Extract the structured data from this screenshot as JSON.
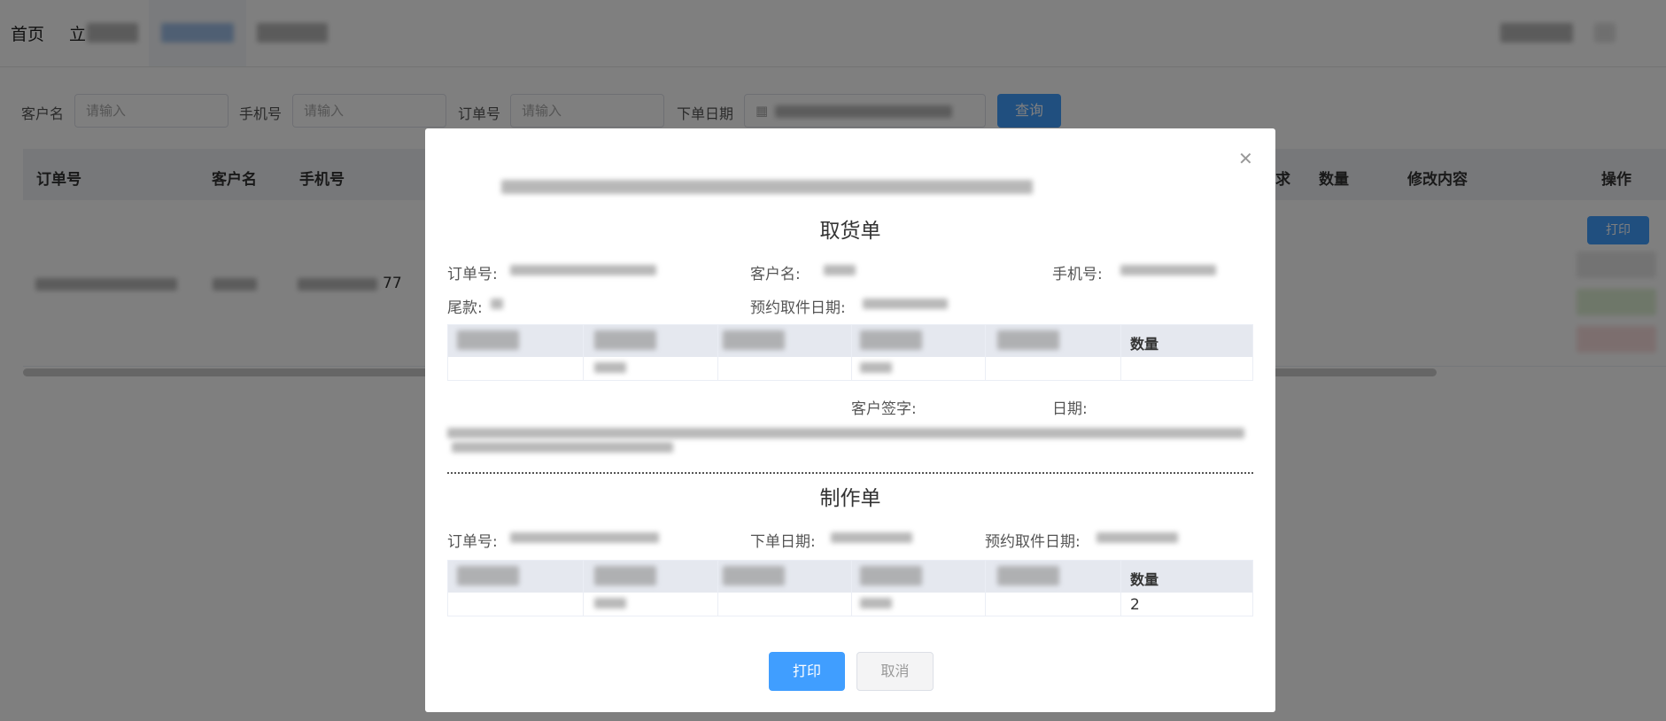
{
  "nav": {
    "home": "首页",
    "second_initial": "立"
  },
  "search": {
    "customer_label": "客户名",
    "customer_placeholder": "请输入",
    "phone_label": "手机号",
    "phone_placeholder": "请输入",
    "order_label": "订单号",
    "order_placeholder": "请输入",
    "date_label": "下单日期",
    "query_button": "查询"
  },
  "table": {
    "headers": {
      "order_no": "订单号",
      "customer": "客户名",
      "phone": "手机号",
      "requirement_partial": "求",
      "quantity": "数量",
      "modification": "修改内容",
      "actions": "操作"
    },
    "row": {
      "phone_suffix": "77"
    },
    "print_button": "打印"
  },
  "modal": {
    "pickup": {
      "title": "取货单",
      "order_label": "订单号:",
      "customer_label": "客户名:",
      "phone_label": "手机号:",
      "balance_label": "尾款:",
      "pickup_date_label": "预约取件日期:",
      "qty_header": "数量",
      "signature_label": "客户签字:",
      "date_label": "日期:"
    },
    "production": {
      "title": "制作单",
      "order_label": "订单号:",
      "order_date_label": "下单日期:",
      "pickup_date_label": "预约取件日期:",
      "qty_header": "数量",
      "qty_value": "2"
    },
    "print_button": "打印",
    "cancel_button": "取消"
  },
  "colors": {
    "primary": "#409eff",
    "button_blue": "#2f7fd8"
  }
}
